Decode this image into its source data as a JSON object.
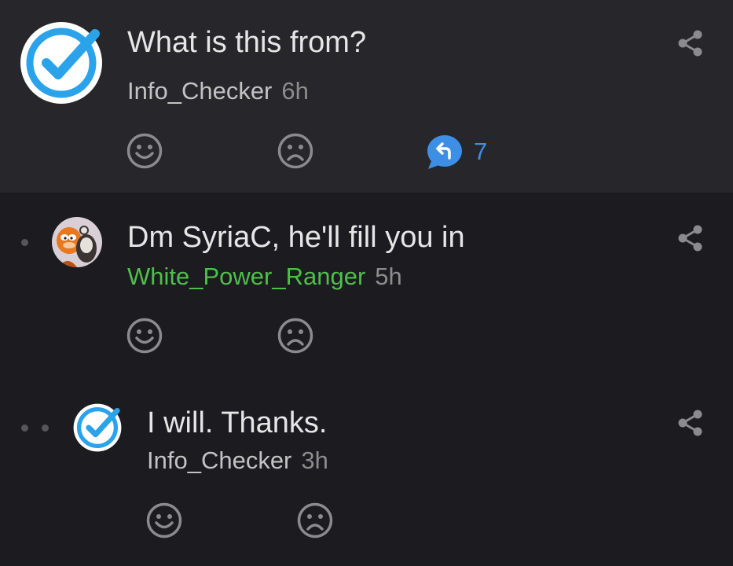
{
  "post": {
    "title": "What is this from?",
    "username": "Info_Checker",
    "time": "6h",
    "reply_count": "7"
  },
  "comments": [
    {
      "text": "Dm SyriaC, he'll fill you in",
      "username": "White_Power_Ranger",
      "time": "5h",
      "depth": 1
    },
    {
      "text": "I will. Thanks.",
      "username": "Info_Checker",
      "time": "3h",
      "depth": 2
    }
  ],
  "colors": {
    "post_bg": "#26262b",
    "page_bg": "#1b1b20",
    "accent_blue": "#2aa3ea",
    "reply_blue": "#3d8fe6",
    "username_green": "#4fbf4a"
  },
  "icons": {
    "verified": "checkmark-badge-icon",
    "happy": "smiley-face-icon",
    "sad": "sad-face-icon",
    "reply": "reply-bubble-icon",
    "share": "share-icon"
  }
}
